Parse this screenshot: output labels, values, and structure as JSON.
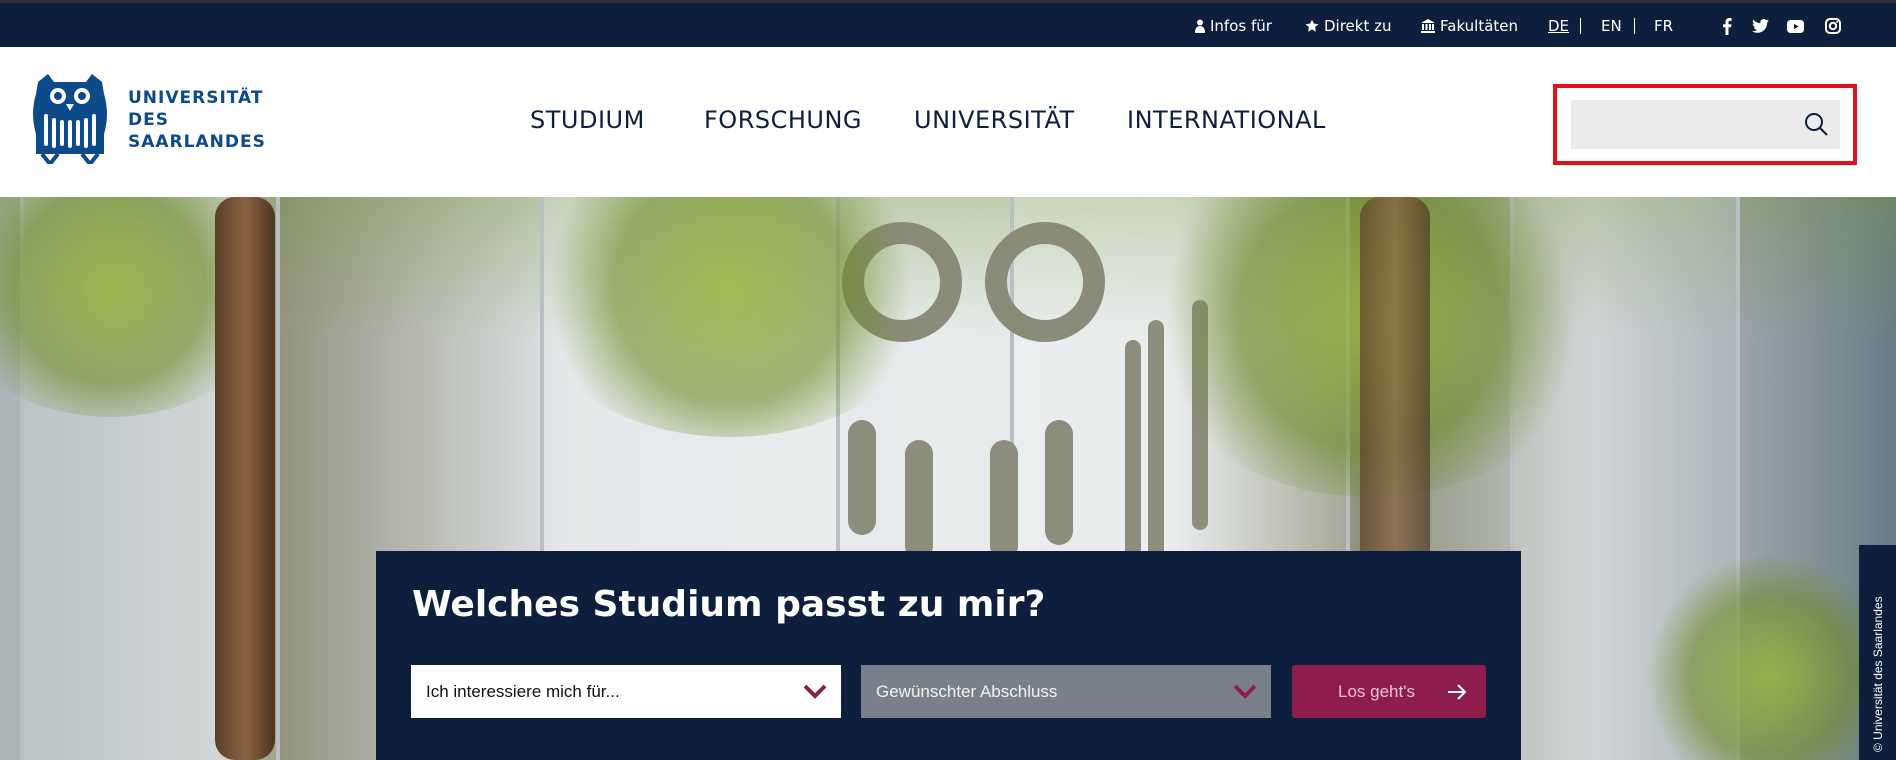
{
  "topbar": {
    "infos_label": "Infos für",
    "direkt_label": "Direkt zu",
    "fakultaeten_label": "Fakultäten",
    "languages": [
      "DE",
      "EN",
      "FR"
    ],
    "active_language": "DE",
    "social_icons": [
      "facebook-icon",
      "twitter-icon",
      "youtube-icon",
      "instagram-icon"
    ]
  },
  "header": {
    "logo_lines": [
      "UNIVERSITÄT",
      "DES",
      "SAARLANDES"
    ],
    "nav": [
      "STUDIUM",
      "FORSCHUNG",
      "UNIVERSITÄT",
      "INTERNATIONAL"
    ],
    "search": {
      "placeholder": "",
      "value": ""
    }
  },
  "hero": {
    "copyright": "© Universität des Saarlandes"
  },
  "finder": {
    "title": "Welches Studium passt zu mir?",
    "interest_select": "Ich interessiere mich für...",
    "degree_select": "Gewünschter Abschluss",
    "go_label": "Los geht's"
  },
  "colors": {
    "navy": "#0d1f3c",
    "brand_blue": "#0d4a8a",
    "accent_magenta": "#8e1d4c",
    "highlight_red": "#e3101b"
  }
}
